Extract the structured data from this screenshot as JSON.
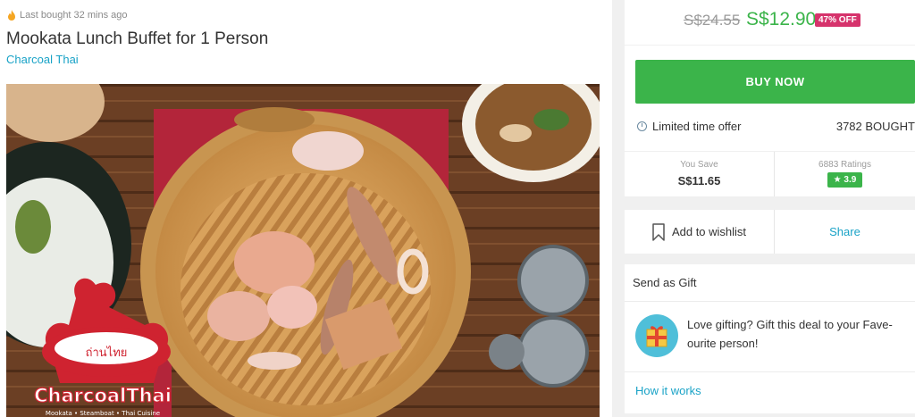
{
  "deal": {
    "last_bought": "Last bought 32 mins ago",
    "title": "Mookata Lunch Buffet for 1 Person",
    "merchant": "Charcoal Thai"
  },
  "photo": {
    "logo_text": "CharcoalThai",
    "logo_thai": "ถ่านไทย",
    "logo_tagline": "Mookata • Steamboat • Thai Cuisine"
  },
  "pricing": {
    "original_price": "S$24.55",
    "sale_price": "S$12.90",
    "discount": "47% OFF"
  },
  "purchase": {
    "buy_label": "BUY NOW",
    "limited_label": "Limited time offer",
    "bought_count": "3782 BOUGHT"
  },
  "stats": {
    "save_label": "You Save",
    "save_value": "S$11.65",
    "ratings_label": "6883 Ratings",
    "rating_value": "★ 3.9"
  },
  "actions": {
    "wishlist_label": "Add to wishlist",
    "share_label": "Share"
  },
  "gift": {
    "heading": "Send as Gift",
    "text": "Love gifting? Gift this deal to your Fave-ourite person!",
    "how_link": "How it works"
  },
  "colors": {
    "accent_green": "#3bb44a",
    "link_blue": "#1aa3c7",
    "discount_pink": "#d6336c"
  }
}
